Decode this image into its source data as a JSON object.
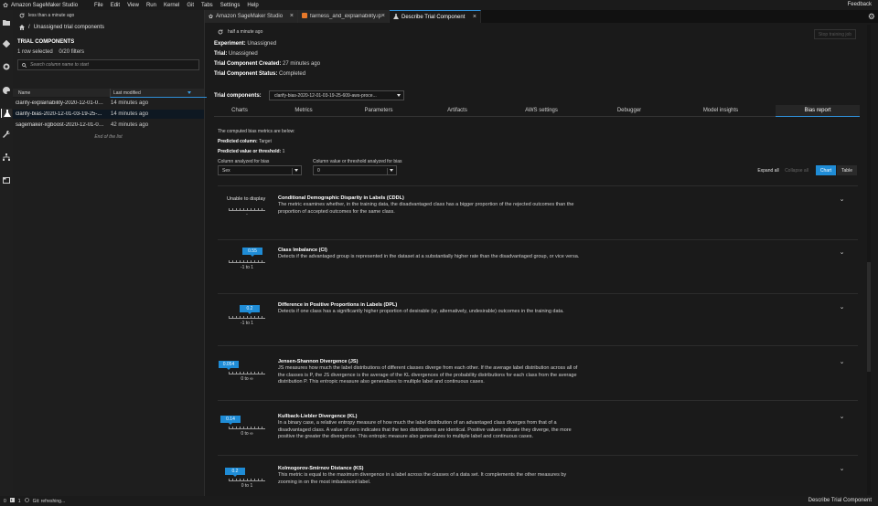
{
  "menubar": {
    "app_title": "Amazon SageMaker Studio",
    "menus": [
      "File",
      "Edit",
      "View",
      "Run",
      "Kernel",
      "Git",
      "Tabs",
      "Settings",
      "Help"
    ],
    "feedback": "Feedback"
  },
  "sidebar": {
    "refresh_label": "less than a minute ago",
    "breadcrumb": "Unassigned trial components",
    "section_title": "TRIAL COMPONENTS",
    "selection_info": "1 row selected    0/20 filters",
    "search_placeholder": "Search column name to start",
    "columns": {
      "name": "Name",
      "modified": "Last modified"
    },
    "rows": [
      {
        "name": "clarify-explainability-2020-12-01-03-...",
        "modified": "14 minutes ago"
      },
      {
        "name": "clarify-bias-2020-12-01-03-19-25-...",
        "modified": "14 minutes ago"
      },
      {
        "name": "sagemaker-xgboost-2020-12-01-03-...",
        "modified": "42 minutes ago"
      }
    ],
    "end_of_list": "End of the list"
  },
  "tabs": [
    {
      "label": "Amazon SageMaker Studio",
      "icon": "sagemaker-logo-icon"
    },
    {
      "label": "fairness_and_explainability.ip",
      "icon": "notebook-icon"
    },
    {
      "label": "Describe Trial Component",
      "icon": "experiment-flask-icon"
    }
  ],
  "main": {
    "refresh_label": "half a minute ago",
    "stop_button": "Stop training job",
    "experiment": {
      "label": "Experiment:",
      "value": "Unassigned"
    },
    "trial": {
      "label": "Trial:",
      "value": "Unassigned"
    },
    "created": {
      "label": "Trial Component Created:",
      "value": "27 minutes ago"
    },
    "status": {
      "label": "Trial Component Status:",
      "value": "Completed"
    },
    "trial_components_label": "Trial components:",
    "trial_component_selected": "clarify-bias-2020-12-01-03-19-25-609-aws-proce...",
    "subtabs": [
      "Charts",
      "Metrics",
      "Parameters",
      "Artifacts",
      "AWS settings",
      "Debugger",
      "Model insights",
      "Bias report"
    ],
    "active_subtab": "Bias report"
  },
  "bias": {
    "intro": "The computed bias metrics are below:",
    "predicted_column_label": "Predicted column:",
    "predicted_column_value": "Target",
    "predicted_value_label": "Predicted value or threshold:",
    "predicted_value_value": "1",
    "column_label": "Column analyzed for bias",
    "column_value": "Sex",
    "threshold_label": "Column value or threshold analyzed for bias",
    "threshold_value": "0",
    "expand_all": "Expand all",
    "collapse_all": "Collapse all",
    "view_chart": "Chart",
    "view_table": "Table",
    "metrics": [
      {
        "unable": "Unable to display",
        "range": "-",
        "title": "Conditional Demographic Disparity in Labels (CDDL)",
        "description": "The metric examines whether, in the training data, the disadvantaged class has a bigger proportion of the rejected outcomes than the proportion of accepted outcomes for the same class."
      },
      {
        "value": "0.55",
        "range": "-1 to 1",
        "title": "Class Imbalance (CI)",
        "description": "Detects if the advantaged group is represented in the dataset at a substantially higher rate than the disadvantaged group, or vice versa."
      },
      {
        "value": "0.2",
        "range": "-1 to 1",
        "title": "Difference in Positive Proportions in Labels (DPL)",
        "description": "Detects if one class has a significantly higher proportion of desirable (or, alternatively, undesirable) outcomes in the training data."
      },
      {
        "value": "0.054",
        "range": "0 to ∞",
        "title": "Jensen-Shannon Divergence (JS)",
        "description": "JS measures how much the label distributions of different classes diverge from each other. If the average label distribution across all of the classes is P, the JS divergence is the average of the KL divergences of the probability distributions for each class from the average distribution P. This entropic measure also generalizes to multiple label and continuous cases."
      },
      {
        "value": "0.14",
        "range": "0 to ∞",
        "title": "Kullback-Liebler Divergence (KL)",
        "description": "In a binary case, a relative entropy measure of how much the label distribution of an advantaged class diverges from that of a disadvantaged class. A value of zero indicates that the two distributions are identical. Positive values indicate they diverge, the more positive the greater the divergence. This entropic measure also generalizes to multiple label and continuous cases."
      },
      {
        "value": "0.2",
        "range": "0 to 1",
        "title": "Kolmogorov-Smirnov Distance (KS)",
        "description": "This metric is equal to the maximum divergence in a label across the classes of a data set. It complements the other measures by zooming in on the most imbalanced label."
      }
    ]
  },
  "statusbar": {
    "count_a": "0",
    "count_b": "1",
    "git": "Git: refreshing...",
    "right": "Describe Trial Component"
  },
  "colors": {
    "accent": "#1f8cd6",
    "background": "#1a1a1a",
    "panel": "#1e1e1e"
  }
}
